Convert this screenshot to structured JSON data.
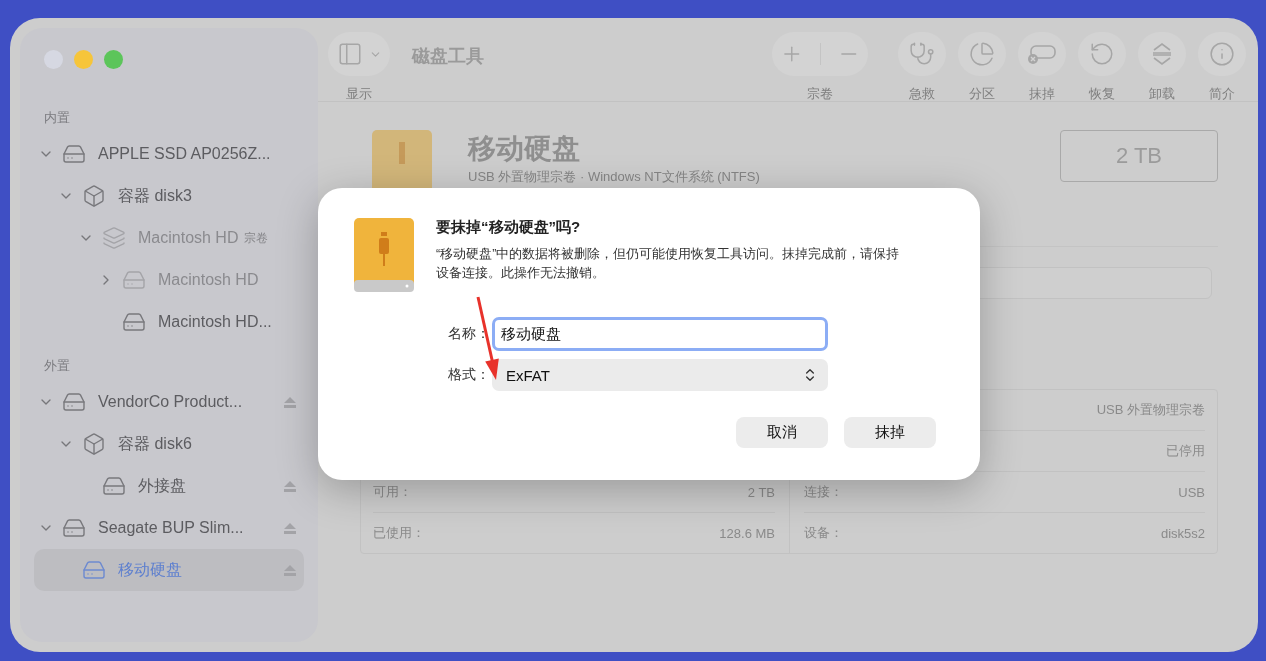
{
  "window": {
    "title": "磁盘工具",
    "traffic_lights": [
      {
        "kind": "close",
        "dimmed": true
      },
      {
        "kind": "minimize",
        "dimmed": false
      },
      {
        "kind": "zoom",
        "dimmed": false
      }
    ]
  },
  "toolbar": {
    "view_button": {
      "label": "显示"
    },
    "volume_group": {
      "label": "宗卷",
      "buttons": [
        {
          "kind": "add"
        },
        {
          "kind": "remove"
        }
      ]
    },
    "buttons": [
      {
        "kind": "first-aid",
        "label": "急救"
      },
      {
        "kind": "partition",
        "label": "分区"
      },
      {
        "kind": "erase",
        "label": "抹掉"
      },
      {
        "kind": "restore",
        "label": "恢复"
      },
      {
        "kind": "unmount",
        "label": "卸载"
      },
      {
        "kind": "info",
        "label": "简介"
      }
    ]
  },
  "sidebar": {
    "sections": [
      {
        "title": "内置",
        "items": [
          {
            "label": "APPLE SSD AP0256Z...",
            "kind": "drive",
            "expanded": true,
            "dimmed": false,
            "eject": false,
            "selected": false,
            "children": [
              {
                "label": "容器 disk3",
                "kind": "container",
                "expanded": true,
                "dimmed": false,
                "eject": false,
                "selected": false,
                "children": [
                  {
                    "label": "Macintosh HD",
                    "tag": "宗卷",
                    "kind": "volumes",
                    "expanded": true,
                    "dimmed": true,
                    "eject": false,
                    "selected": false,
                    "children": [
                      {
                        "label": "Macintosh HD",
                        "kind": "volume",
                        "expanded": false,
                        "dimmed": true,
                        "eject": false,
                        "selected": false
                      },
                      {
                        "label": "Macintosh HD...",
                        "kind": "volume",
                        "dimmed": false,
                        "eject": false,
                        "selected": false
                      }
                    ]
                  }
                ]
              }
            ]
          }
        ]
      },
      {
        "title": "外置",
        "items": [
          {
            "label": "VendorCo Product...",
            "kind": "drive",
            "expanded": true,
            "dimmed": false,
            "eject": true,
            "selected": false,
            "children": [
              {
                "label": "容器 disk6",
                "kind": "container",
                "expanded": true,
                "dimmed": false,
                "eject": false,
                "selected": false,
                "children": [
                  {
                    "label": "外接盘",
                    "kind": "volume",
                    "dimmed": false,
                    "eject": true,
                    "selected": false
                  }
                ]
              }
            ]
          },
          {
            "label": "Seagate BUP Slim...",
            "kind": "drive",
            "expanded": true,
            "dimmed": false,
            "eject": true,
            "selected": false,
            "children": [
              {
                "label": "移动硬盘",
                "kind": "volume",
                "dimmed": false,
                "eject": true,
                "selected": true
              }
            ]
          }
        ]
      }
    ]
  },
  "volume": {
    "name": "移动硬盘",
    "subtitle": "USB 外置物理宗卷 · Windows NT文件系统 (NTFS)",
    "capacity": "2 TB"
  },
  "info_table": {
    "left": [
      {
        "label": "可用：",
        "value": "2 TB"
      },
      {
        "label": "已使用：",
        "value": "128.6 MB"
      }
    ],
    "right": [
      {
        "value": "USB 外置物理宗卷"
      },
      {
        "value": "已停用"
      },
      {
        "label": "连接：",
        "value": "USB"
      },
      {
        "label": "设备：",
        "value": "disk5s2"
      }
    ]
  },
  "dialog": {
    "title": "要抹掉“移动硬盘”吗?",
    "message": "“移动硬盘”中的数据将被删除，但仍可能使用恢复工具访问。抹掉完成前，请保持设备连接。此操作无法撤销。",
    "fields": [
      {
        "kind": "text",
        "label": "名称：",
        "value": "移动硬盘",
        "focused": true
      },
      {
        "kind": "select",
        "label": "格式：",
        "value": "ExFAT"
      }
    ],
    "buttons": [
      {
        "label": "取消"
      },
      {
        "label": "抹掉"
      }
    ]
  }
}
